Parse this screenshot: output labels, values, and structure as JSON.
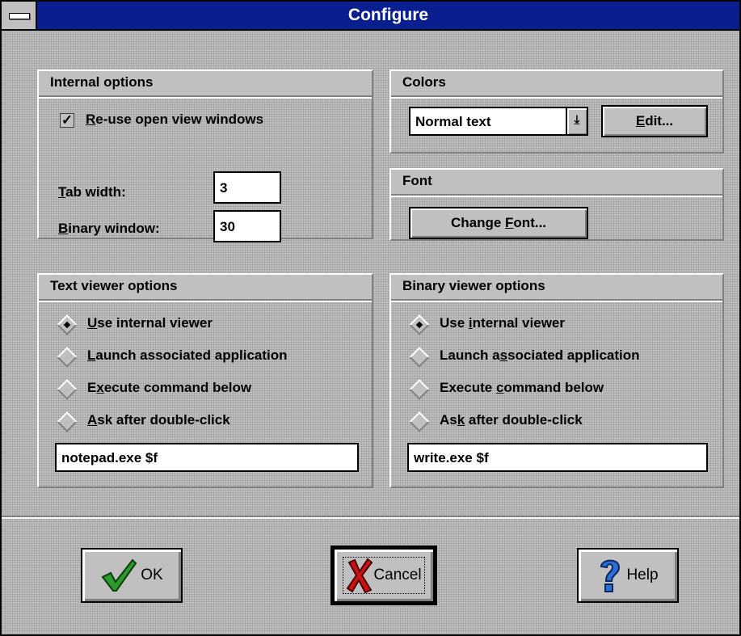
{
  "window": {
    "title": "Configure"
  },
  "internal": {
    "heading": "Internal options",
    "reuse_check": "✓",
    "reuse_pre": "",
    "reuse_key": "R",
    "reuse_post": "e-use open view windows",
    "tab_pre": "",
    "tab_key": "T",
    "tab_post": "ab width:",
    "tab_value": "3",
    "bin_pre": "",
    "bin_key": "B",
    "bin_post": "inary window:",
    "bin_value": "30"
  },
  "colors": {
    "heading": "Colors",
    "selected": "Normal text",
    "arrow": "⤓",
    "edit_pre": "",
    "edit_key": "E",
    "edit_post": "dit..."
  },
  "font": {
    "heading": "Font",
    "change_pre": "Change ",
    "change_key": "F",
    "change_post": "ont..."
  },
  "text_viewer": {
    "heading": "Text viewer options",
    "options": [
      {
        "pre": "",
        "key": "U",
        "post": "se internal viewer"
      },
      {
        "pre": "",
        "key": "L",
        "post": "aunch associated application"
      },
      {
        "pre": "E",
        "key": "x",
        "post": "ecute command below"
      },
      {
        "pre": "",
        "key": "A",
        "post": "sk after double-click"
      }
    ],
    "command": "notepad.exe $f"
  },
  "binary_viewer": {
    "heading": "Binary viewer options",
    "options": [
      {
        "pre": "Use ",
        "key": "i",
        "post": "nternal viewer"
      },
      {
        "pre": "Launch a",
        "key": "s",
        "post": "sociated application"
      },
      {
        "pre": "Execute ",
        "key": "c",
        "post": "ommand below"
      },
      {
        "pre": "As",
        "key": "k",
        "post": " after double-click"
      }
    ],
    "command": "write.exe $f"
  },
  "buttons": {
    "ok": "OK",
    "cancel": "Cancel",
    "help": "Help"
  },
  "colors_theme": {
    "titlebar": "#0a1f8f",
    "face": "#c0c0c0",
    "ok_check": "#2a9a2a",
    "cancel_x": "#cc1111",
    "help_q": "#2a6fd6"
  }
}
